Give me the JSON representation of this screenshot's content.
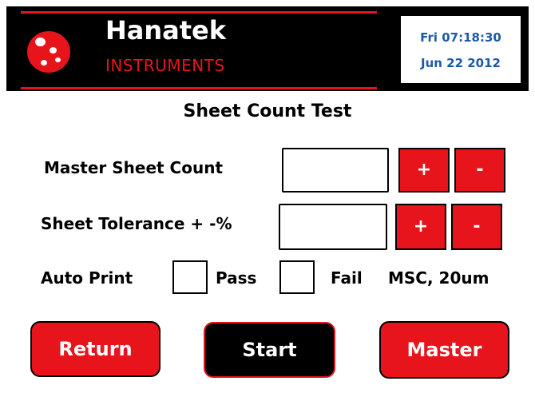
{
  "header": {
    "brand": "Hanatek",
    "brand_sub": "INSTRUMENTS",
    "time": "Fri 07:18:30",
    "date": "Jun 22 2012",
    "colors": {
      "accent": "#e8141c",
      "header_bg": "#000000",
      "datetime_text": "#1c5aa8"
    }
  },
  "main": {
    "title": "Sheet Count Test",
    "master_sheet_count": {
      "label": "Master Sheet Count",
      "value": "",
      "plus": "+",
      "minus": "-"
    },
    "sheet_tolerance": {
      "label": "Sheet Tolerance + -%",
      "value": "",
      "plus": "+",
      "minus": "-"
    },
    "auto_print": {
      "label": "Auto Print",
      "pass_label": "Pass",
      "fail_label": "Fail",
      "pass_checked": false,
      "fail_checked": false
    },
    "mode": "MSC, 20um"
  },
  "footer": {
    "return_label": "Return",
    "start_label": "Start",
    "master_label": "Master"
  }
}
